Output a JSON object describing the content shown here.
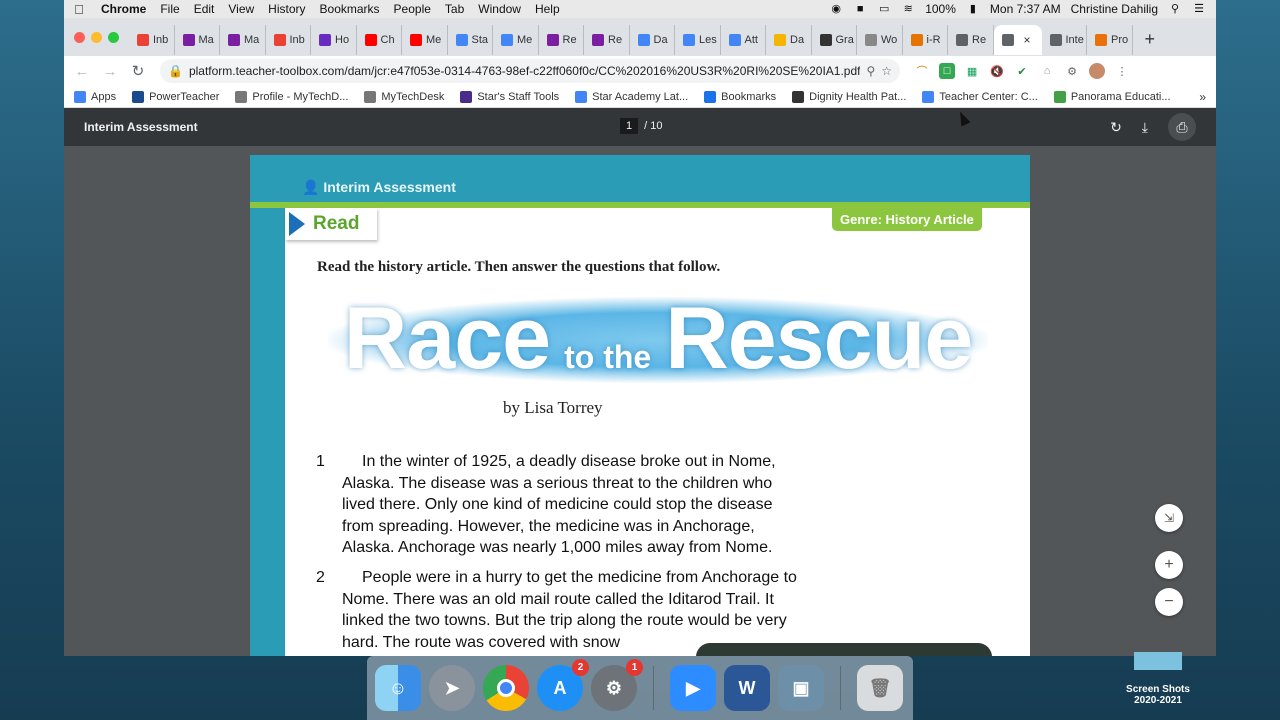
{
  "menubar": {
    "items": [
      "Chrome",
      "File",
      "Edit",
      "View",
      "History",
      "Bookmarks",
      "People",
      "Tab",
      "Window",
      "Help"
    ],
    "battery": "100%",
    "clock": "Mon 7:37 AM",
    "user": "Christine Dahilig"
  },
  "tabs": [
    {
      "label": "Inb",
      "icon": "gmail-icon",
      "color": "#ea4335"
    },
    {
      "label": "Ma",
      "icon": "onenote-icon",
      "color": "#7b1fa2"
    },
    {
      "label": "Ma",
      "icon": "onenote-icon",
      "color": "#7b1fa2"
    },
    {
      "label": "Inb",
      "icon": "gmail-icon",
      "color": "#ea4335"
    },
    {
      "label": "Ho",
      "icon": "m-icon",
      "color": "#6a2bbf"
    },
    {
      "label": "Ch",
      "icon": "youtube-icon",
      "color": "#ff0000"
    },
    {
      "label": "Me",
      "icon": "youtube-icon",
      "color": "#ff0000"
    },
    {
      "label": "Sta",
      "icon": "docs-icon",
      "color": "#4285f4"
    },
    {
      "label": "Me",
      "icon": "docs-icon",
      "color": "#4285f4"
    },
    {
      "label": "Re",
      "icon": "onenote-icon",
      "color": "#7b1fa2"
    },
    {
      "label": "Re",
      "icon": "onenote-icon",
      "color": "#7b1fa2"
    },
    {
      "label": "Da",
      "icon": "docs-icon",
      "color": "#4285f4"
    },
    {
      "label": "Les",
      "icon": "docs-icon",
      "color": "#4285f4"
    },
    {
      "label": "Att",
      "icon": "docs-icon",
      "color": "#4285f4"
    },
    {
      "label": "Da",
      "icon": "slides-icon",
      "color": "#f4b400"
    },
    {
      "label": "Gra",
      "icon": "s-icon",
      "color": "#333333"
    },
    {
      "label": "Wo",
      "icon": "gear-icon",
      "color": "#888888"
    },
    {
      "label": "i-R",
      "icon": "cube-icon",
      "color": "#e37400"
    },
    {
      "label": "Re",
      "icon": "globe-icon",
      "color": "#5f6368"
    },
    {
      "label": "",
      "icon": "globe-icon",
      "color": "#5f6368",
      "active": true
    },
    {
      "label": "Inte",
      "icon": "globe-icon",
      "color": "#5f6368"
    },
    {
      "label": "Pro",
      "icon": "p-icon",
      "color": "#e8710a"
    }
  ],
  "address": {
    "url": "platform.teacher-toolbox.com/dam/jcr:e47f053e-0314-4763-98ef-c22ff060f0c/CC%202016%20US3R%20RI%20SE%20IA1.pdf"
  },
  "bookmarks": [
    {
      "label": "Apps",
      "icon": "apps-grid-icon",
      "color": "#4285f4"
    },
    {
      "label": "PowerTeacher",
      "icon": "powerteacher-icon",
      "color": "#1a4b8c"
    },
    {
      "label": "Profile - MyTechD...",
      "icon": "cloud-icon",
      "color": "#777777"
    },
    {
      "label": "MyTechDesk",
      "icon": "cloud-icon",
      "color": "#777777"
    },
    {
      "label": "Star's Staff Tools",
      "icon": "star-staff-icon",
      "color": "#4a2c8a"
    },
    {
      "label": "Star Academy Lat...",
      "icon": "docs-icon",
      "color": "#4285f4"
    },
    {
      "label": "Bookmarks",
      "icon": "star-icon",
      "color": "#1a73e8"
    },
    {
      "label": "Dignity Health Pat...",
      "icon": "globe-icon",
      "color": "#333333"
    },
    {
      "label": "Teacher Center: C...",
      "icon": "google-icon",
      "color": "#4285f4"
    },
    {
      "label": "Panorama Educati...",
      "icon": "panorama-icon",
      "color": "#43a047"
    }
  ],
  "pdf": {
    "title": "Interim Assessment",
    "page_current": "1",
    "page_total": "/ 10"
  },
  "document": {
    "banner": "Interim Assessment",
    "read_label": "Read",
    "genre": "Genre: History Article",
    "instructions": "Read the history article. Then answer the questions that follow.",
    "title_part1": "Race",
    "title_part2": "to the",
    "title_part3": "Rescue",
    "byline": "by Lisa Torrey",
    "paragraphs": [
      {
        "num": "1",
        "text": "In the winter of 1925, a deadly disease broke out in Nome, Alaska. The disease was a serious threat to the children who lived there. Only one kind of medicine could stop the disease from spreading. However, the medicine was in Anchorage, Alaska. Anchorage was nearly 1,000 miles away from Nome."
      },
      {
        "num": "2",
        "text": "People were in a hurry to get the medicine from Anchorage to Nome. There was an old mail route called the Iditarod Trail. It linked the two towns. But the trip along the route would be very hard. The route was covered with snow"
      }
    ]
  },
  "dock": {
    "apps": [
      {
        "name": "finder",
        "badge": ""
      },
      {
        "name": "launchpad",
        "badge": ""
      },
      {
        "name": "chrome",
        "badge": ""
      },
      {
        "name": "app-store",
        "badge": "2"
      },
      {
        "name": "system-preferences",
        "badge": "1"
      },
      {
        "name": "zoom",
        "badge": ""
      },
      {
        "name": "word",
        "badge": ""
      },
      {
        "name": "preview",
        "badge": ""
      },
      {
        "name": "trash",
        "badge": ""
      }
    ],
    "folder_label_line1": "Screen Shots",
    "folder_label_line2": "2020-2021"
  }
}
